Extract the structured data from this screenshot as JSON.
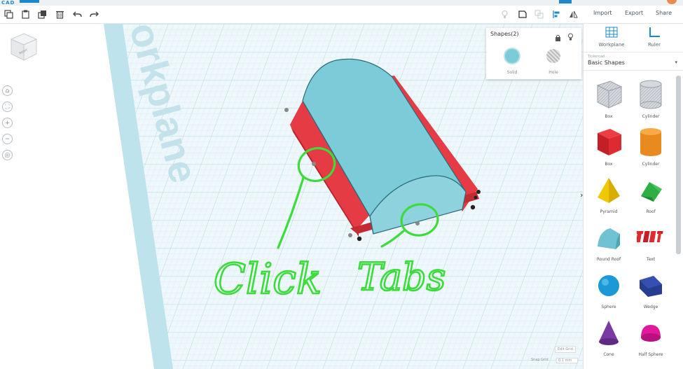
{
  "app": {
    "logo_text": "CAD"
  },
  "toolbar": {
    "import_label": "Import",
    "export_label": "Export",
    "share_label": "Share"
  },
  "right_panel": {
    "workplane_label": "Workplane",
    "ruler_label": "Ruler",
    "library_small": "Tinkercad",
    "library_name": "Basic Shapes",
    "shapes": [
      {
        "label": "Box",
        "icon": "box-hole-icon"
      },
      {
        "label": "Cylinder",
        "icon": "cylinder-hole-icon"
      },
      {
        "label": "Box",
        "icon": "box-icon"
      },
      {
        "label": "Cylinder",
        "icon": "cylinder-icon"
      },
      {
        "label": "Pyramid",
        "icon": "pyramid-icon"
      },
      {
        "label": "Roof",
        "icon": "roof-icon"
      },
      {
        "label": "Round Roof",
        "icon": "round-roof-icon"
      },
      {
        "label": "Text",
        "icon": "text-icon"
      },
      {
        "label": "Sphere",
        "icon": "sphere-icon"
      },
      {
        "label": "Wedge",
        "icon": "wedge-icon"
      },
      {
        "label": "Cone",
        "icon": "cone-icon"
      },
      {
        "label": "Half Sphere",
        "icon": "half-sphere-icon"
      }
    ]
  },
  "inspector": {
    "title": "Shapes(2)",
    "solid_label": "Solid",
    "hole_label": "Hole"
  },
  "viewcube": {
    "label": "RIGHT"
  },
  "canvas": {
    "workplane_text": "orkplane",
    "annotation_left": "Click",
    "annotation_right": "Tabs"
  },
  "grid": {
    "edit_grid_label": "Edit Grid",
    "snap_grid_label": "Snap Grid",
    "snap_value": "0.1 mm"
  },
  "colors": {
    "accent": "#1e88c9",
    "shape_blue": "#7cc9d6",
    "shape_red": "#e63b45",
    "annotation_green": "#3ddc3d",
    "grid_line": "#cfe3ea",
    "workplane_edge": "#bde3ec"
  }
}
